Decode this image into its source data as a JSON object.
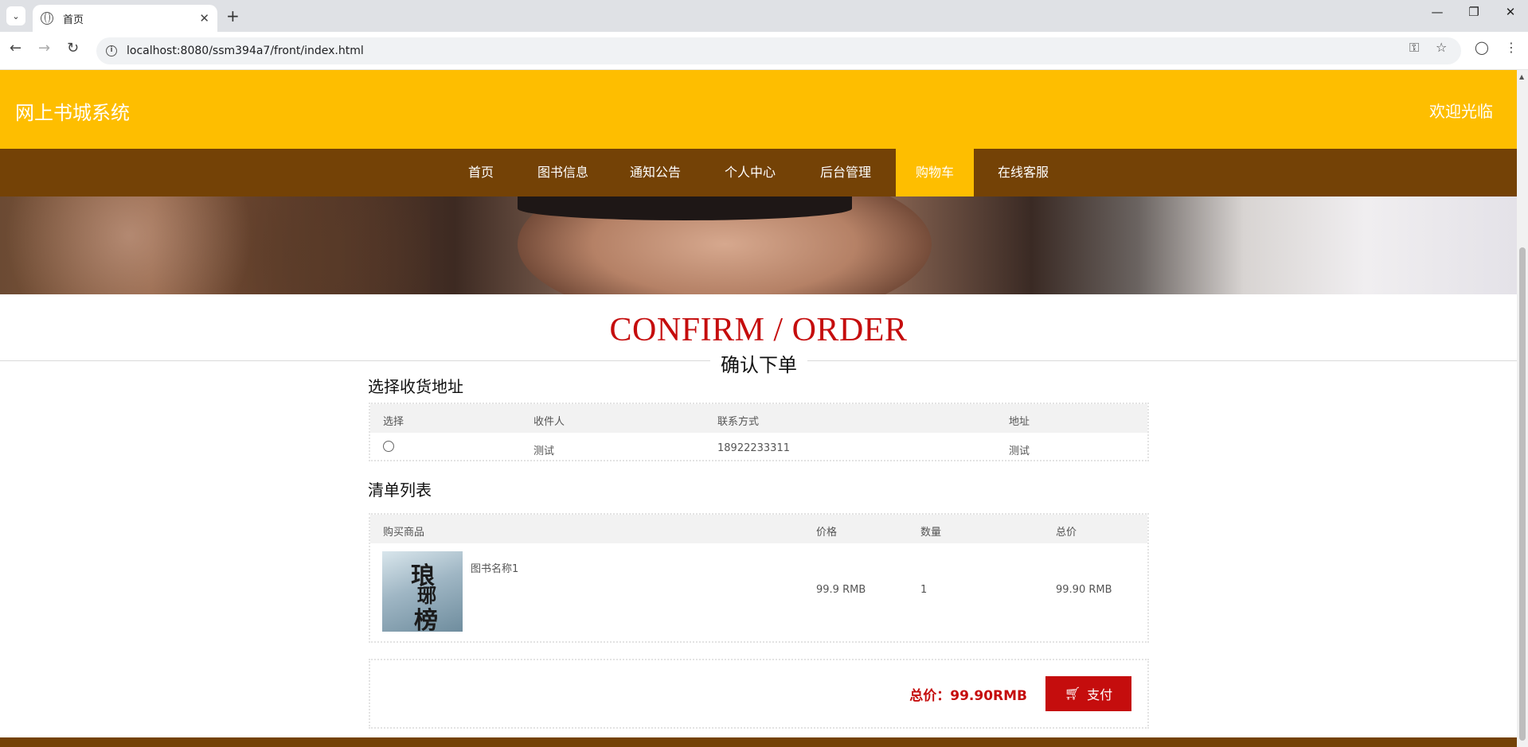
{
  "browser": {
    "tab_title": "首页",
    "url": "localhost:8080/ssm394a7/front/index.html"
  },
  "header": {
    "site_title": "网上书城系统",
    "welcome": "欢迎光临"
  },
  "nav": {
    "items": [
      {
        "label": "首页"
      },
      {
        "label": "图书信息"
      },
      {
        "label": "通知公告"
      },
      {
        "label": "个人中心"
      },
      {
        "label": "后台管理"
      },
      {
        "label": "购物车",
        "active": true
      },
      {
        "label": "在线客服"
      }
    ]
  },
  "page": {
    "heading_en": "CONFIRM / ORDER",
    "heading_cn": "确认下单"
  },
  "address_section": {
    "title": "选择收货地址",
    "columns": [
      "选择",
      "收件人",
      "联系方式",
      "地址"
    ],
    "rows": [
      {
        "recipient": "测试",
        "phone": "18922233311",
        "address": "测试"
      }
    ]
  },
  "order_section": {
    "title": "清单列表",
    "columns": [
      "购买商品",
      "价格",
      "数量",
      "总价"
    ],
    "items": [
      {
        "name": "图书名称1",
        "price": "99.9 RMB",
        "quantity": "1",
        "total": "99.90 RMB"
      }
    ]
  },
  "checkout": {
    "total_text": "总价：99.90RMB",
    "pay_label": "支付"
  },
  "colors": {
    "header_bg": "#febe00",
    "nav_bg": "#744206",
    "accent_red": "#c50d0d"
  }
}
